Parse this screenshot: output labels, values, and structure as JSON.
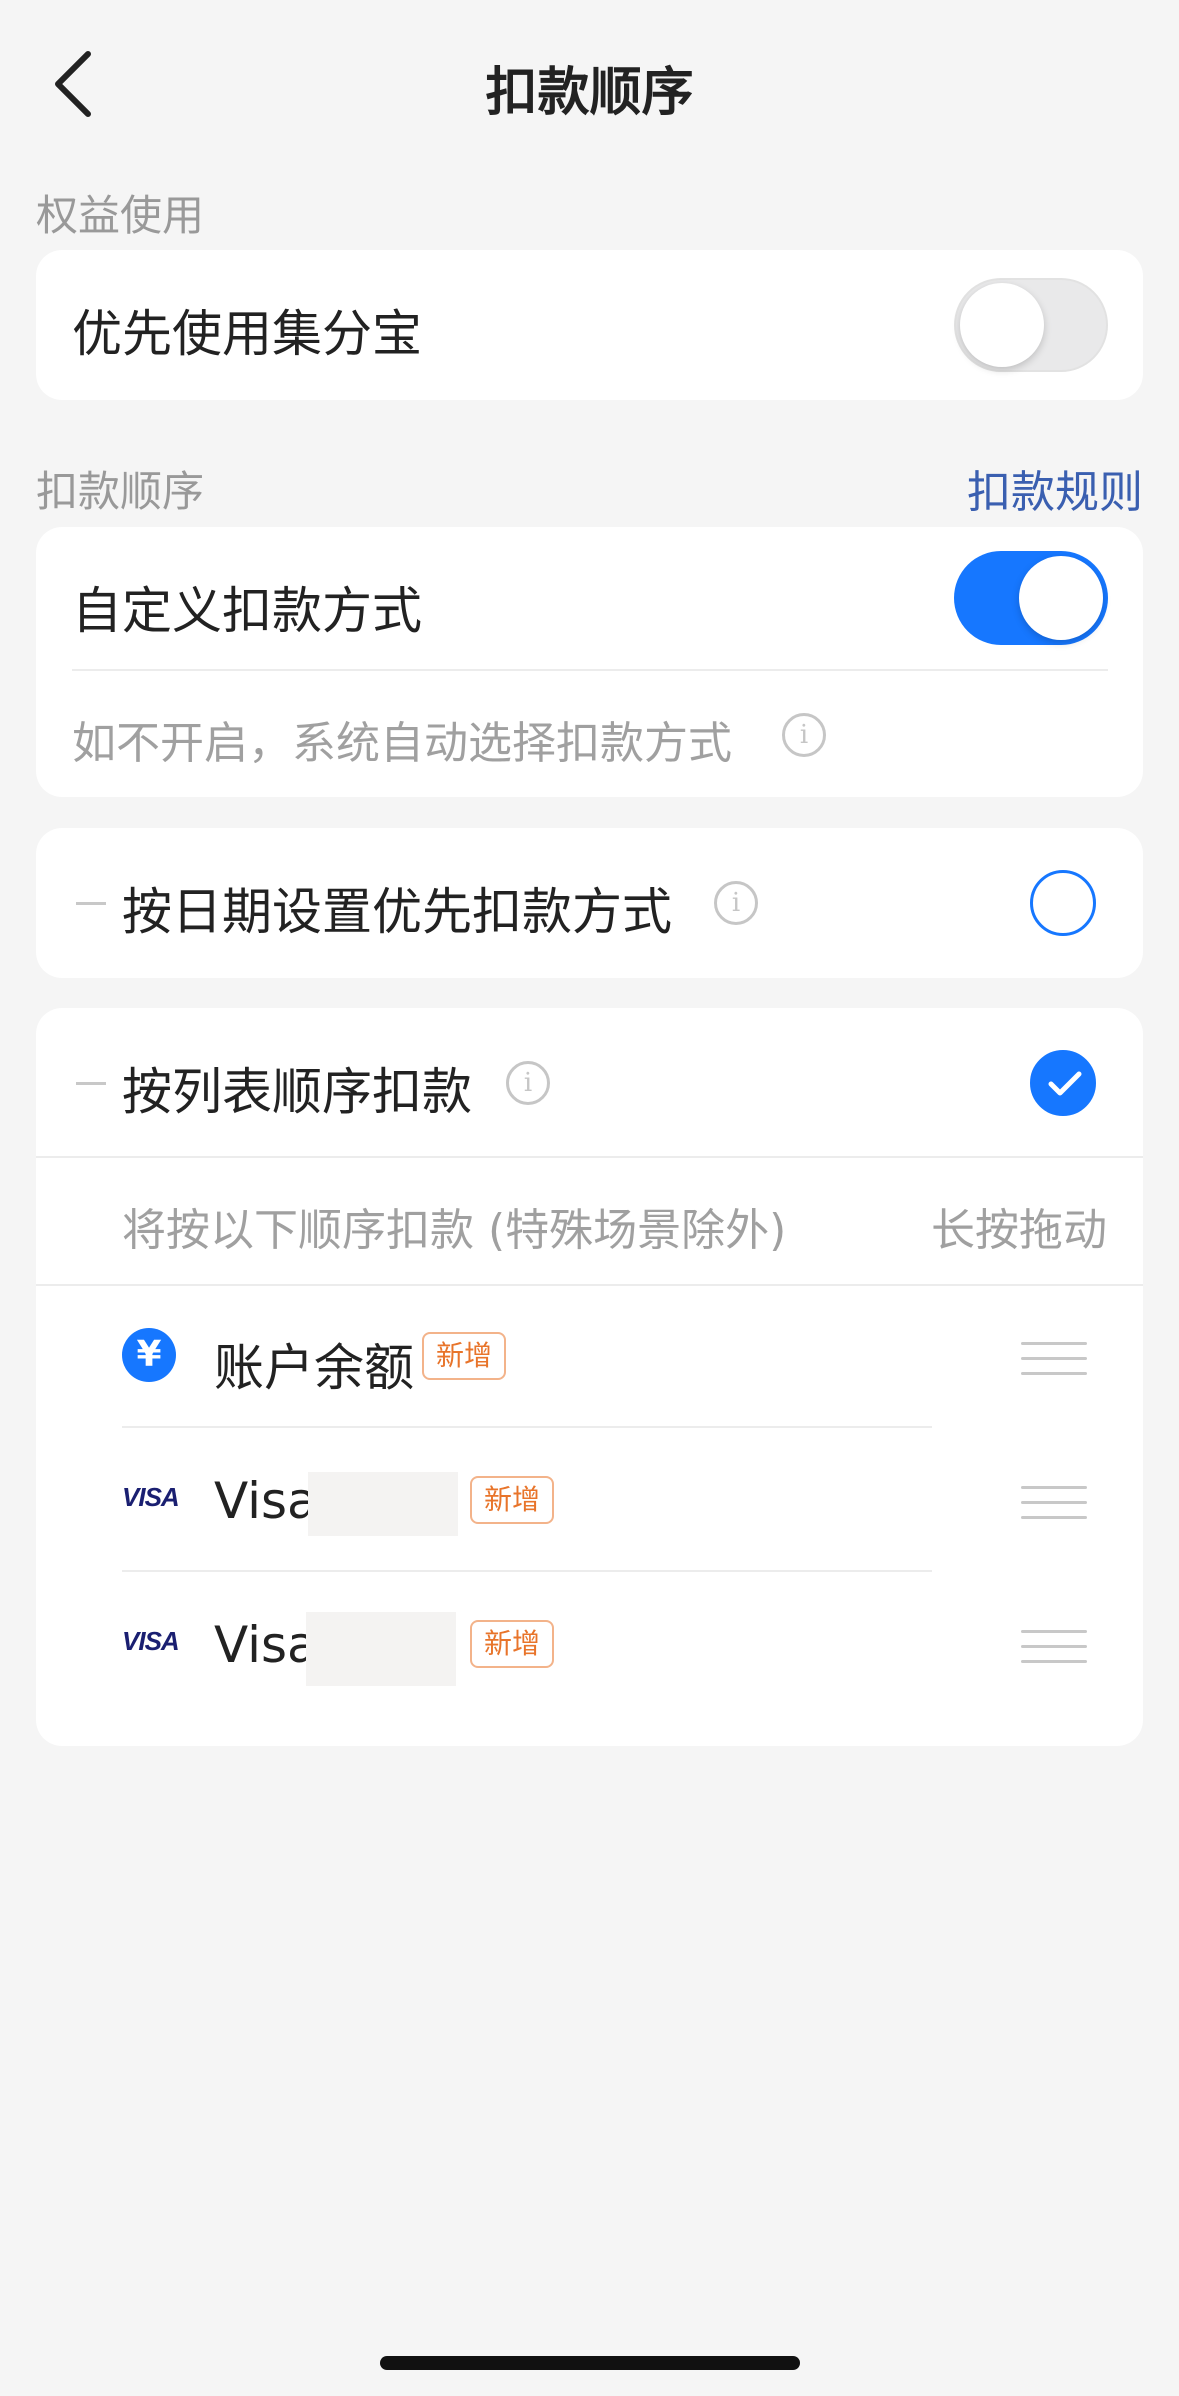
{
  "nav": {
    "title": "扣款顺序",
    "back_icon": "chevron-left-icon"
  },
  "benefits": {
    "section_label": "权益使用",
    "points_toggle": {
      "label": "优先使用集分宝",
      "on": false
    }
  },
  "order": {
    "section_label": "扣款顺序",
    "rules_link": "扣款规则",
    "custom_toggle": {
      "label": "自定义扣款方式",
      "on": true
    },
    "custom_hint": "如不开启，系统自动选择扣款方式",
    "by_date": {
      "label": "按日期设置优先扣款方式",
      "selected": false
    },
    "by_list": {
      "label": "按列表顺序扣款",
      "selected": true
    },
    "list_hint": "将按以下顺序扣款 (特殊场景除外)",
    "drag_hint": "长按拖动",
    "items": [
      {
        "icon": "yen-icon",
        "icon_text": "¥",
        "name": "账户余额",
        "badge": "新增"
      },
      {
        "icon": "visa-icon",
        "icon_text": "VISA",
        "name": "Visa",
        "badge": "新增"
      },
      {
        "icon": "visa-icon",
        "icon_text": "VISA",
        "name": "Visa",
        "badge": "新增"
      }
    ]
  },
  "colors": {
    "accent": "#1677ff",
    "link": "#3a5fb0",
    "badge": "#e8742a",
    "background": "#f5f5f5"
  }
}
